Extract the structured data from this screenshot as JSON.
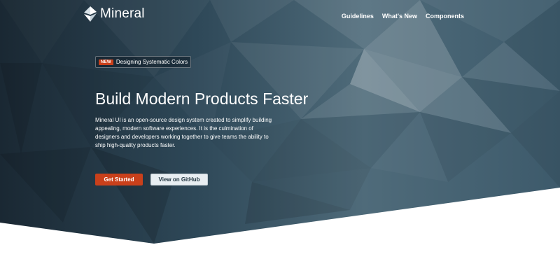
{
  "brand": {
    "name": "Mineral",
    "logo_icon": "mineral-logo-icon"
  },
  "nav": {
    "links": [
      {
        "label": "Guidelines"
      },
      {
        "label": "What's New"
      },
      {
        "label": "Components"
      }
    ]
  },
  "announcement": {
    "badge": "NEW",
    "text": "Designing Systematic Colors"
  },
  "hero": {
    "title": "Build Modern Products Faster",
    "description": "Mineral UI is an open-source design system created to simplify building appealing, modern software experiences. It is the culmination of designers and developers working together to give teams the ability to ship high-quality products faster."
  },
  "actions": {
    "primary_label": "Get Started",
    "secondary_label": "View on GitHub"
  },
  "colors": {
    "hero_dark": "#1e2f3b",
    "hero_mid": "#3d5a6b",
    "hero_light": "#7f9aa8",
    "accent": "#c9401b",
    "page_bg": "#ffffff"
  }
}
